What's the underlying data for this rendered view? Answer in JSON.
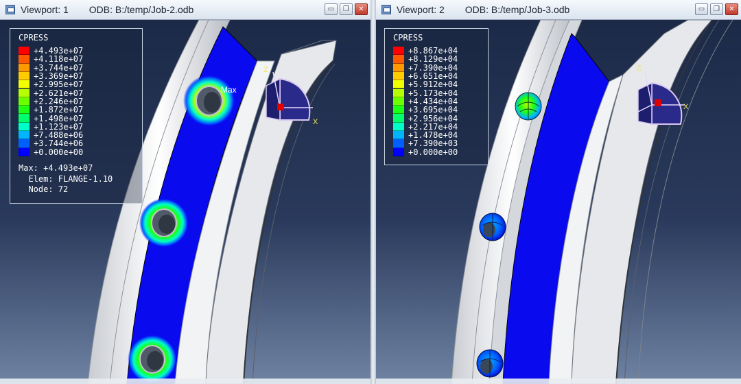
{
  "viewports": [
    {
      "title": "Viewport: 1",
      "odb": "ODB: B:/temp/Job-2.odb",
      "legend": {
        "title": "CPRESS",
        "entries": [
          {
            "label": "+4.493e+07",
            "color": "#ff0000"
          },
          {
            "label": "+4.118e+07",
            "color": "#ff5a00"
          },
          {
            "label": "+3.744e+07",
            "color": "#ff9900"
          },
          {
            "label": "+3.369e+07",
            "color": "#ffcc00"
          },
          {
            "label": "+2.995e+07",
            "color": "#f2ff00"
          },
          {
            "label": "+2.621e+07",
            "color": "#b6ff00"
          },
          {
            "label": "+2.246e+07",
            "color": "#6cff00"
          },
          {
            "label": "+1.872e+07",
            "color": "#1eff16"
          },
          {
            "label": "+1.498e+07",
            "color": "#00ff6c"
          },
          {
            "label": "+1.123e+07",
            "color": "#00ffc8"
          },
          {
            "label": "+7.488e+06",
            "color": "#00b4ff"
          },
          {
            "label": "+3.744e+06",
            "color": "#0060ff"
          },
          {
            "label": "+0.000e+00",
            "color": "#0000ff"
          }
        ],
        "info": [
          "Max: +4.493e+07",
          "  Elem: FLANGE-1.10",
          "  Node: 72"
        ]
      },
      "max_marker": "Max",
      "triad": {
        "z": "Z",
        "x": "X"
      }
    },
    {
      "title": "Viewport: 2",
      "odb": "ODB: B:/temp/Job-3.odb",
      "legend": {
        "title": "CPRESS",
        "entries": [
          {
            "label": "+8.867e+04",
            "color": "#ff0000"
          },
          {
            "label": "+8.129e+04",
            "color": "#ff5a00"
          },
          {
            "label": "+7.390e+04",
            "color": "#ff9900"
          },
          {
            "label": "+6.651e+04",
            "color": "#ffcc00"
          },
          {
            "label": "+5.912e+04",
            "color": "#f2ff00"
          },
          {
            "label": "+5.173e+04",
            "color": "#b6ff00"
          },
          {
            "label": "+4.434e+04",
            "color": "#6cff00"
          },
          {
            "label": "+3.695e+04",
            "color": "#1eff16"
          },
          {
            "label": "+2.956e+04",
            "color": "#00ff6c"
          },
          {
            "label": "+2.217e+04",
            "color": "#00ffc8"
          },
          {
            "label": "+1.478e+04",
            "color": "#00b4ff"
          },
          {
            "label": "+7.390e+03",
            "color": "#0060ff"
          },
          {
            "label": "+0.000e+00",
            "color": "#0000ff"
          }
        ]
      },
      "triad": {
        "z": "Z",
        "x": "X"
      }
    }
  ],
  "window_buttons": {
    "minimize": "▭",
    "restore": "❐",
    "close": "✕"
  }
}
